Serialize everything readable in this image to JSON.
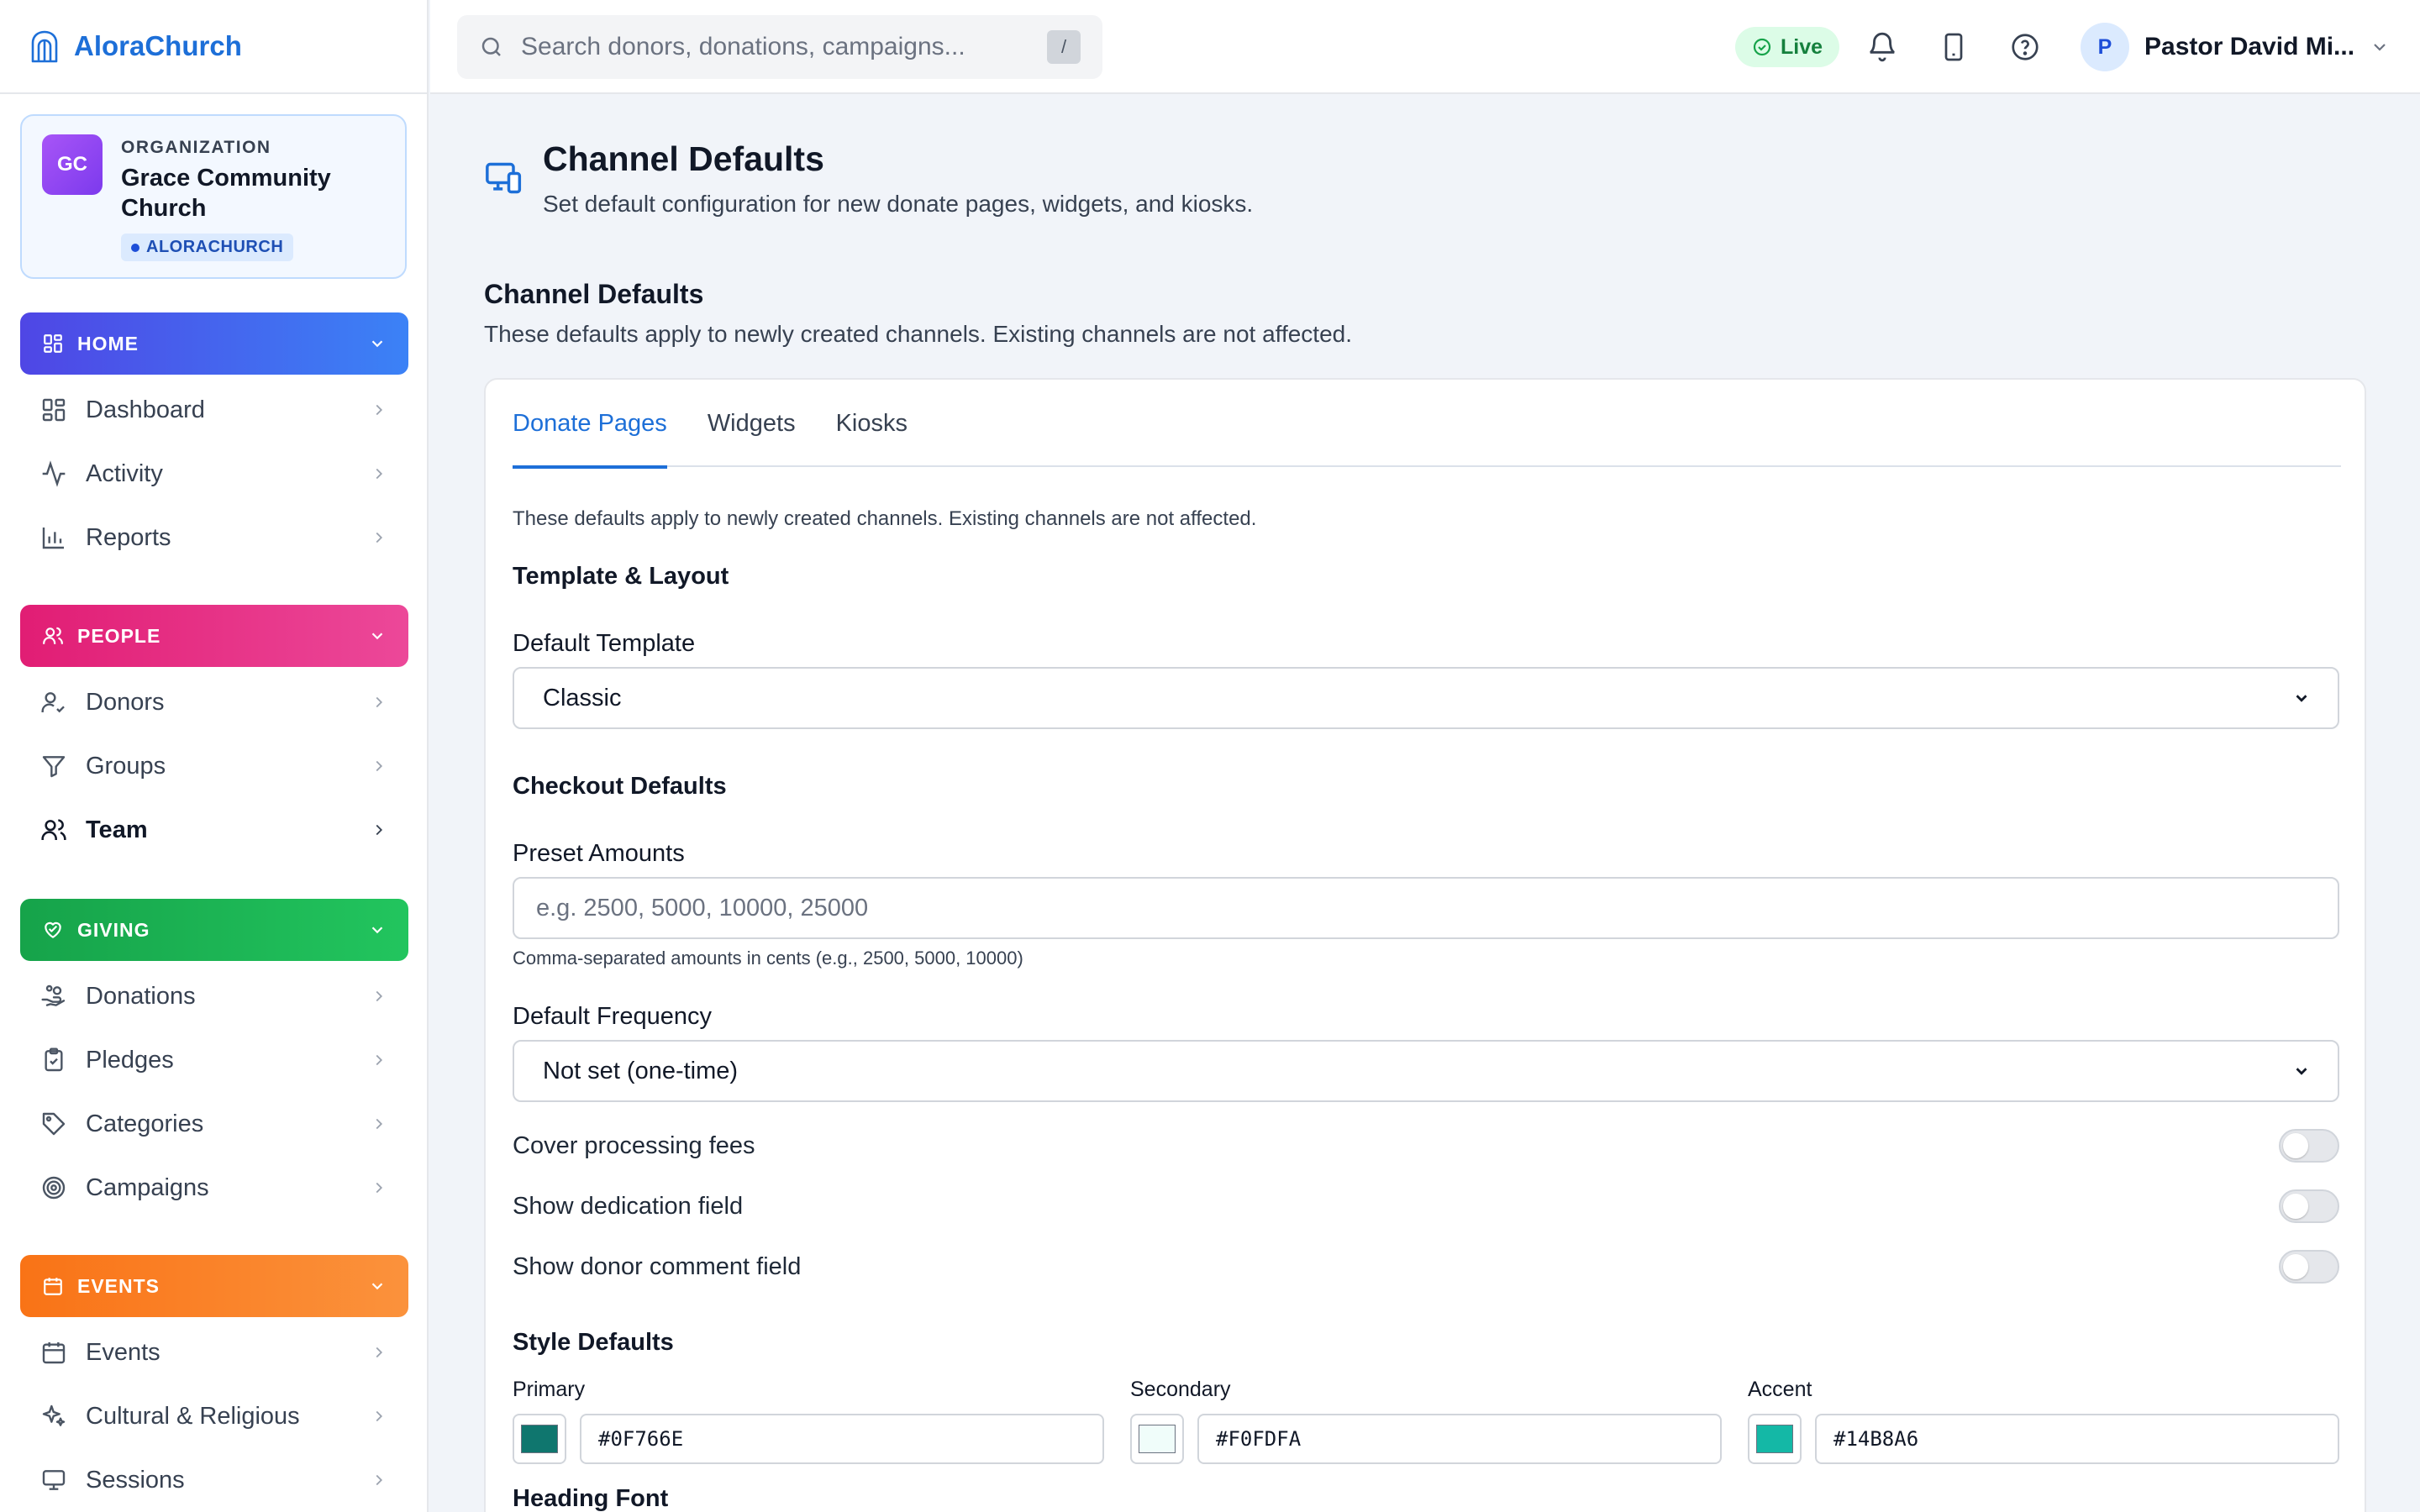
{
  "app": {
    "name": "AloraChurch"
  },
  "org": {
    "initials": "GC",
    "kicker": "ORGANIZATION",
    "name": "Grace Community Church",
    "badge": "ALORACHURCH"
  },
  "sidebar": {
    "home": {
      "label": "HOME",
      "color_from": "#4f46e5",
      "color_to": "#3b82f6",
      "items": [
        {
          "label": "Dashboard",
          "icon": "dashboard-icon"
        },
        {
          "label": "Activity",
          "icon": "activity-icon"
        },
        {
          "label": "Reports",
          "icon": "bar-chart-icon"
        }
      ]
    },
    "people": {
      "label": "PEOPLE",
      "color_from": "#e11d74",
      "color_to": "#ec4899",
      "items": [
        {
          "label": "Donors",
          "icon": "user-check-icon"
        },
        {
          "label": "Groups",
          "icon": "filter-icon"
        },
        {
          "label": "Team",
          "icon": "users-icon",
          "active": true
        }
      ]
    },
    "giving": {
      "label": "GIVING",
      "color_from": "#16a34a",
      "color_to": "#22c55e",
      "items": [
        {
          "label": "Donations",
          "icon": "hand-coins-icon"
        },
        {
          "label": "Pledges",
          "icon": "clipboard-check-icon"
        },
        {
          "label": "Categories",
          "icon": "tag-icon"
        },
        {
          "label": "Campaigns",
          "icon": "target-icon"
        }
      ]
    },
    "events": {
      "label": "EVENTS",
      "color_from": "#f97316",
      "color_to": "#fb923c",
      "items": [
        {
          "label": "Events",
          "icon": "calendar-icon"
        },
        {
          "label": "Cultural & Religious",
          "icon": "sparkles-icon"
        },
        {
          "label": "Sessions",
          "icon": "monitor-icon"
        }
      ]
    }
  },
  "topbar": {
    "search_placeholder": "Search donors, donations, campaigns...",
    "search_shortcut": "/",
    "status": "Live",
    "user_initial": "P",
    "user_name": "Pastor David Mi..."
  },
  "page": {
    "title": "Channel Defaults",
    "subtitle": "Set default configuration for new donate pages, widgets, and kiosks.",
    "section_title": "Channel Defaults",
    "section_desc": "These defaults apply to newly created channels. Existing channels are not affected."
  },
  "tabs": [
    {
      "label": "Donate Pages",
      "active": true
    },
    {
      "label": "Widgets"
    },
    {
      "label": "Kiosks"
    }
  ],
  "form": {
    "note": "These defaults apply to newly created channels. Existing channels are not affected.",
    "template_group": "Template & Layout",
    "template_label": "Default Template",
    "template_value": "Classic",
    "checkout_group": "Checkout Defaults",
    "preset_label": "Preset Amounts",
    "preset_value": "",
    "preset_placeholder": "e.g. 2500, 5000, 10000, 25000",
    "preset_help": "Comma-separated amounts in cents (e.g., 2500, 5000, 10000)",
    "frequency_label": "Default Frequency",
    "frequency_value": "Not set (one-time)",
    "toggles": [
      {
        "label": "Cover processing fees",
        "on": false
      },
      {
        "label": "Show dedication field",
        "on": false
      },
      {
        "label": "Show donor comment field",
        "on": false
      }
    ],
    "style_group": "Style Defaults",
    "colors": {
      "primary_label": "Primary",
      "primary": "#0F766E",
      "secondary_label": "Secondary",
      "secondary": "#F0FDFA",
      "accent_label": "Accent",
      "accent": "#14B8A6"
    },
    "heading_font_label": "Heading Font"
  }
}
